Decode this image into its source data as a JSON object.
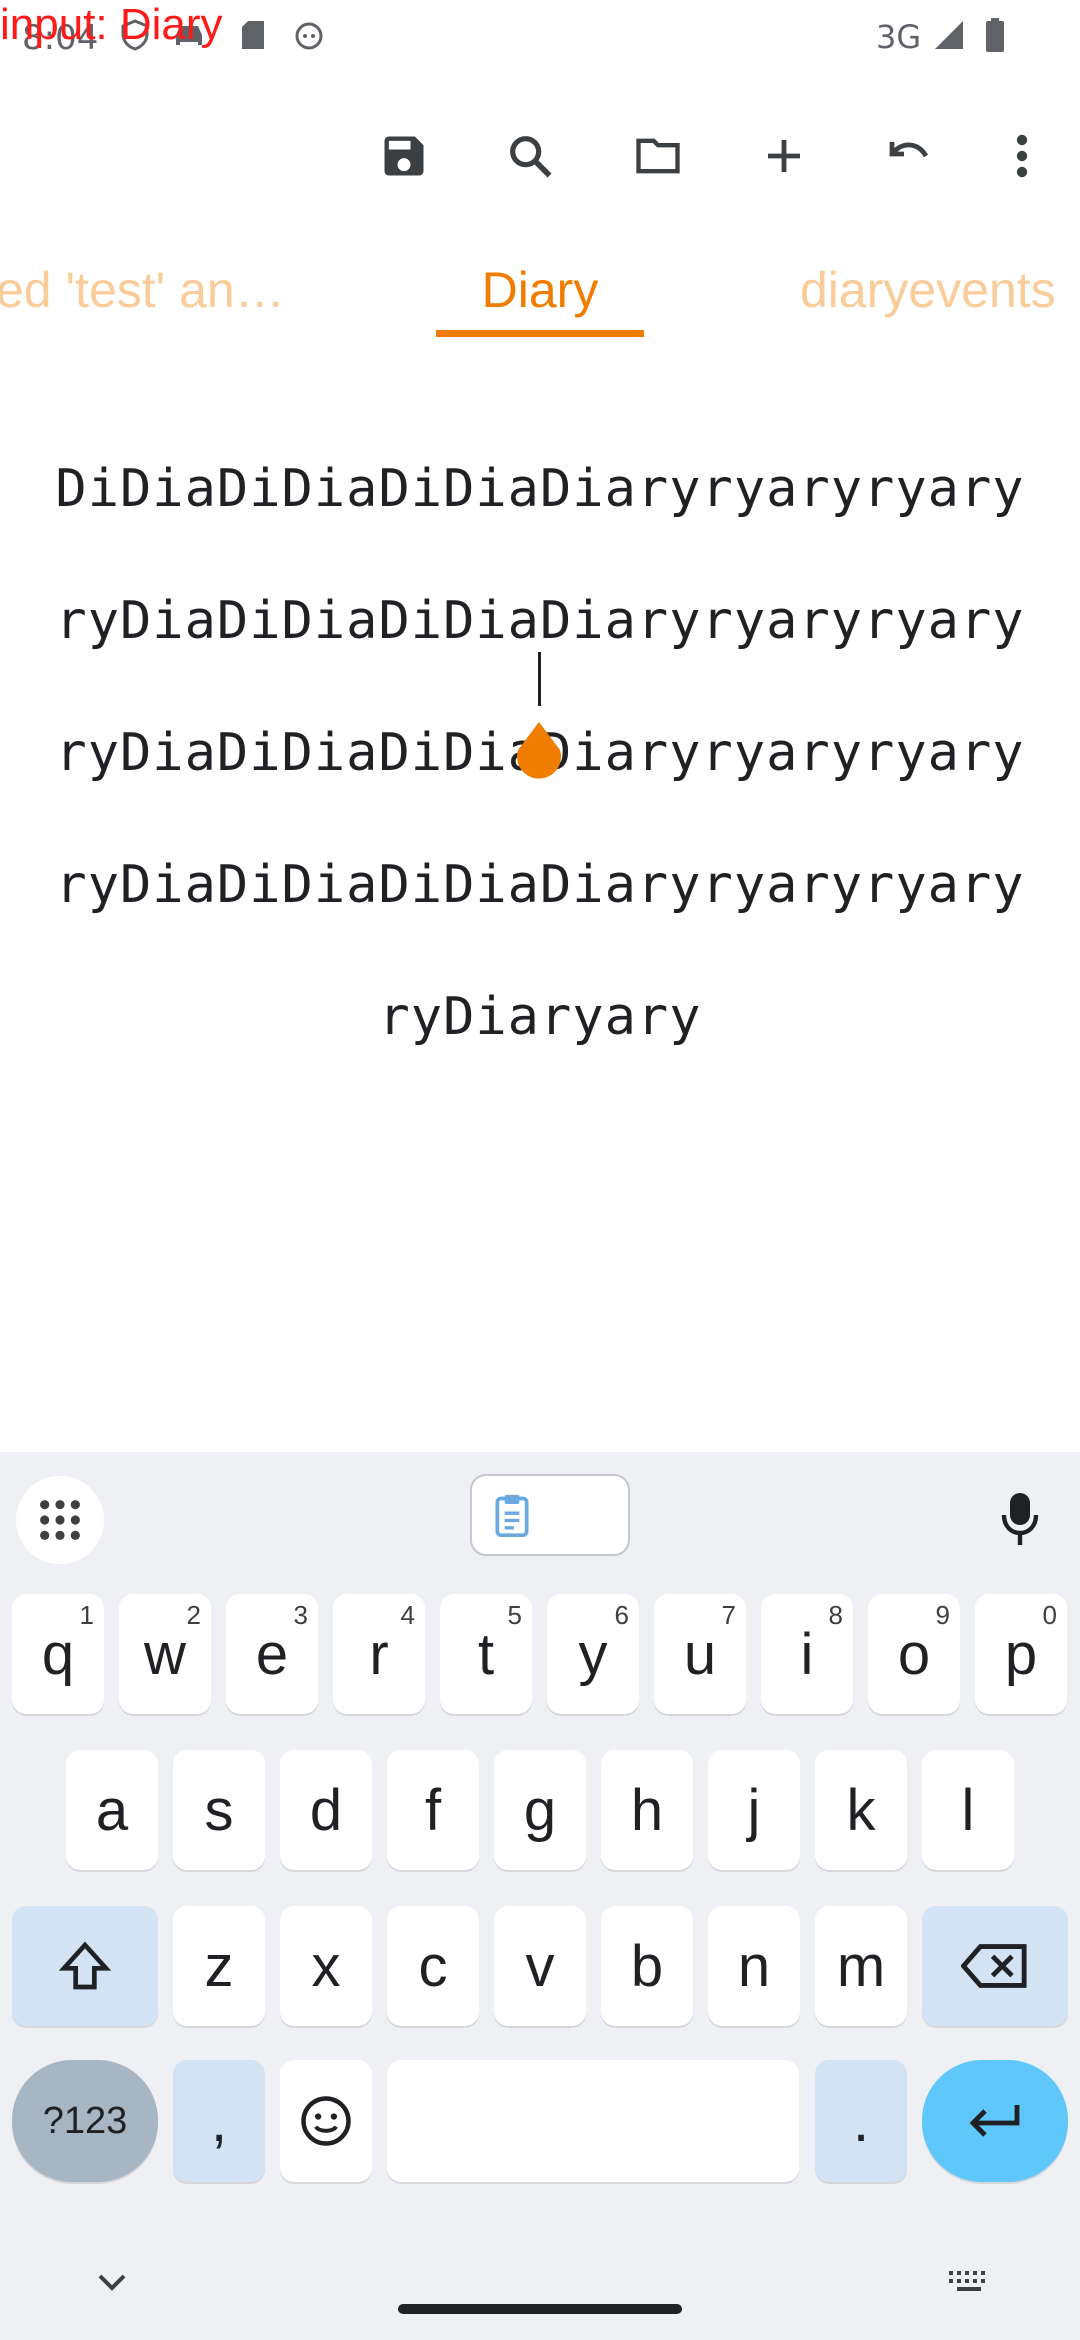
{
  "status_bar": {
    "time": "8:04",
    "network": "3G",
    "debug_overlay": "input: Diary"
  },
  "toolbar": {
    "buttons": [
      "save-icon",
      "search-icon",
      "folder-icon",
      "add-icon",
      "undo-icon",
      "more-icon"
    ]
  },
  "tabs": [
    {
      "label": "ed 'test' an…",
      "active": false
    },
    {
      "label": "Diary",
      "active": true
    },
    {
      "label": "diaryevents",
      "active": false
    }
  ],
  "editor": {
    "lines": [
      "DiDiaDiDiaDiDiaDiaryryaryryary",
      "ryDiaDiDiaDiDiaDiaryryaryryary",
      "ryDiaDiDiaDiDiaDiaryryaryryary",
      "ryDiaDiDiaDiDiaDiaryryaryryary",
      "ryDiaryary"
    ],
    "accent_color": "#f07d00"
  },
  "keyboard": {
    "row1": [
      {
        "key": "q",
        "hint": "1"
      },
      {
        "key": "w",
        "hint": "2"
      },
      {
        "key": "e",
        "hint": "3"
      },
      {
        "key": "r",
        "hint": "4"
      },
      {
        "key": "t",
        "hint": "5"
      },
      {
        "key": "y",
        "hint": "6"
      },
      {
        "key": "u",
        "hint": "7"
      },
      {
        "key": "i",
        "hint": "8"
      },
      {
        "key": "o",
        "hint": "9"
      },
      {
        "key": "p",
        "hint": "0"
      }
    ],
    "row2": [
      "a",
      "s",
      "d",
      "f",
      "g",
      "h",
      "j",
      "k",
      "l"
    ],
    "row3": [
      "z",
      "x",
      "c",
      "v",
      "b",
      "n",
      "m"
    ],
    "symbols_label": "?123",
    "comma_label": ",",
    "period_label": "."
  }
}
